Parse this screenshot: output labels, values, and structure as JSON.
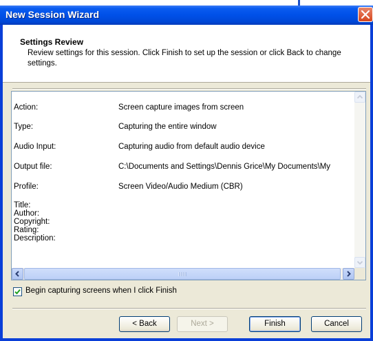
{
  "window": {
    "title": "New Session Wizard"
  },
  "header": {
    "title": "Settings Review",
    "description": "Review settings for this session. Click Finish to set up the session or click Back to change settings."
  },
  "settings": {
    "rows": [
      {
        "label": "Action:",
        "value": "Screen capture images from screen"
      },
      {
        "label": "Type:",
        "value": "Capturing the entire window"
      },
      {
        "label": "Audio Input:",
        "value": "Capturing audio from default audio device"
      },
      {
        "label": "Output file:",
        "value": "C:\\Documents and Settings\\Dennis Grice\\My Documents\\My"
      },
      {
        "label": "Profile:",
        "value": "Screen Video/Audio Medium (CBR)"
      }
    ],
    "metadata": [
      "Title:",
      "Author:",
      "Copyright:",
      "Rating:",
      "Description:"
    ]
  },
  "options": {
    "begin_capture_label": "Begin capturing screens when I click Finish",
    "begin_capture_checked": true
  },
  "buttons": {
    "back": "< Back",
    "next": "Next >",
    "finish": "Finish",
    "cancel": "Cancel"
  },
  "icons": {
    "close": "close-icon",
    "check": "checkmark-icon",
    "scroll_up": "arrow-up-icon",
    "scroll_down": "arrow-down-icon",
    "scroll_left": "arrow-left-icon",
    "scroll_right": "arrow-right-icon"
  },
  "colors": {
    "titlebar": "#0050e8",
    "dialog_face": "#ece9d8",
    "close_button": "#d6461d",
    "checkmark": "#21a121"
  }
}
